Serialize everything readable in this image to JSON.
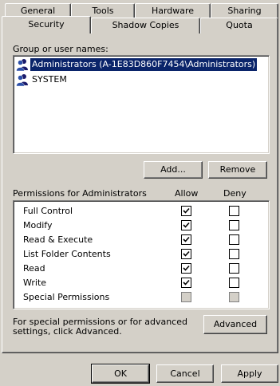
{
  "tabs_row1": [
    {
      "label": "General",
      "underline": "G"
    },
    {
      "label": "Tools",
      "underline": "T"
    },
    {
      "label": "Hardware",
      "underline": "H"
    },
    {
      "label": "Sharing",
      "underline": "S"
    }
  ],
  "tabs_row2": [
    {
      "label": "Security",
      "selected": true
    },
    {
      "label": "Shadow Copies"
    },
    {
      "label": "Quota"
    }
  ],
  "group_label": "Group or user names:",
  "users": [
    {
      "name": "Administrators (A-1E83D860F7454\\Administrators)",
      "selected": true,
      "icon": "user-group-icon"
    },
    {
      "name": "SYSTEM",
      "selected": false,
      "icon": "user-group-icon"
    }
  ],
  "buttons": {
    "add": "Add...",
    "remove": "Remove",
    "advanced": "Advanced",
    "ok": "OK",
    "cancel": "Cancel",
    "apply": "Apply"
  },
  "permissions": {
    "label": "Permissions for Administrators",
    "allow_header": "Allow",
    "deny_header": "Deny",
    "rows": [
      {
        "name": "Full Control",
        "allow": true,
        "deny": false,
        "disabled": false
      },
      {
        "name": "Modify",
        "allow": true,
        "deny": false,
        "disabled": false
      },
      {
        "name": "Read & Execute",
        "allow": true,
        "deny": false,
        "disabled": false
      },
      {
        "name": "List Folder Contents",
        "allow": true,
        "deny": false,
        "disabled": false
      },
      {
        "name": "Read",
        "allow": true,
        "deny": false,
        "disabled": false
      },
      {
        "name": "Write",
        "allow": true,
        "deny": false,
        "disabled": false
      },
      {
        "name": "Special Permissions",
        "allow": false,
        "deny": false,
        "disabled": true
      }
    ]
  },
  "advanced_text": "For special permissions or for advanced settings, click Advanced.",
  "colors": {
    "face": "#d4d0c8",
    "selection": "#0a246a"
  }
}
